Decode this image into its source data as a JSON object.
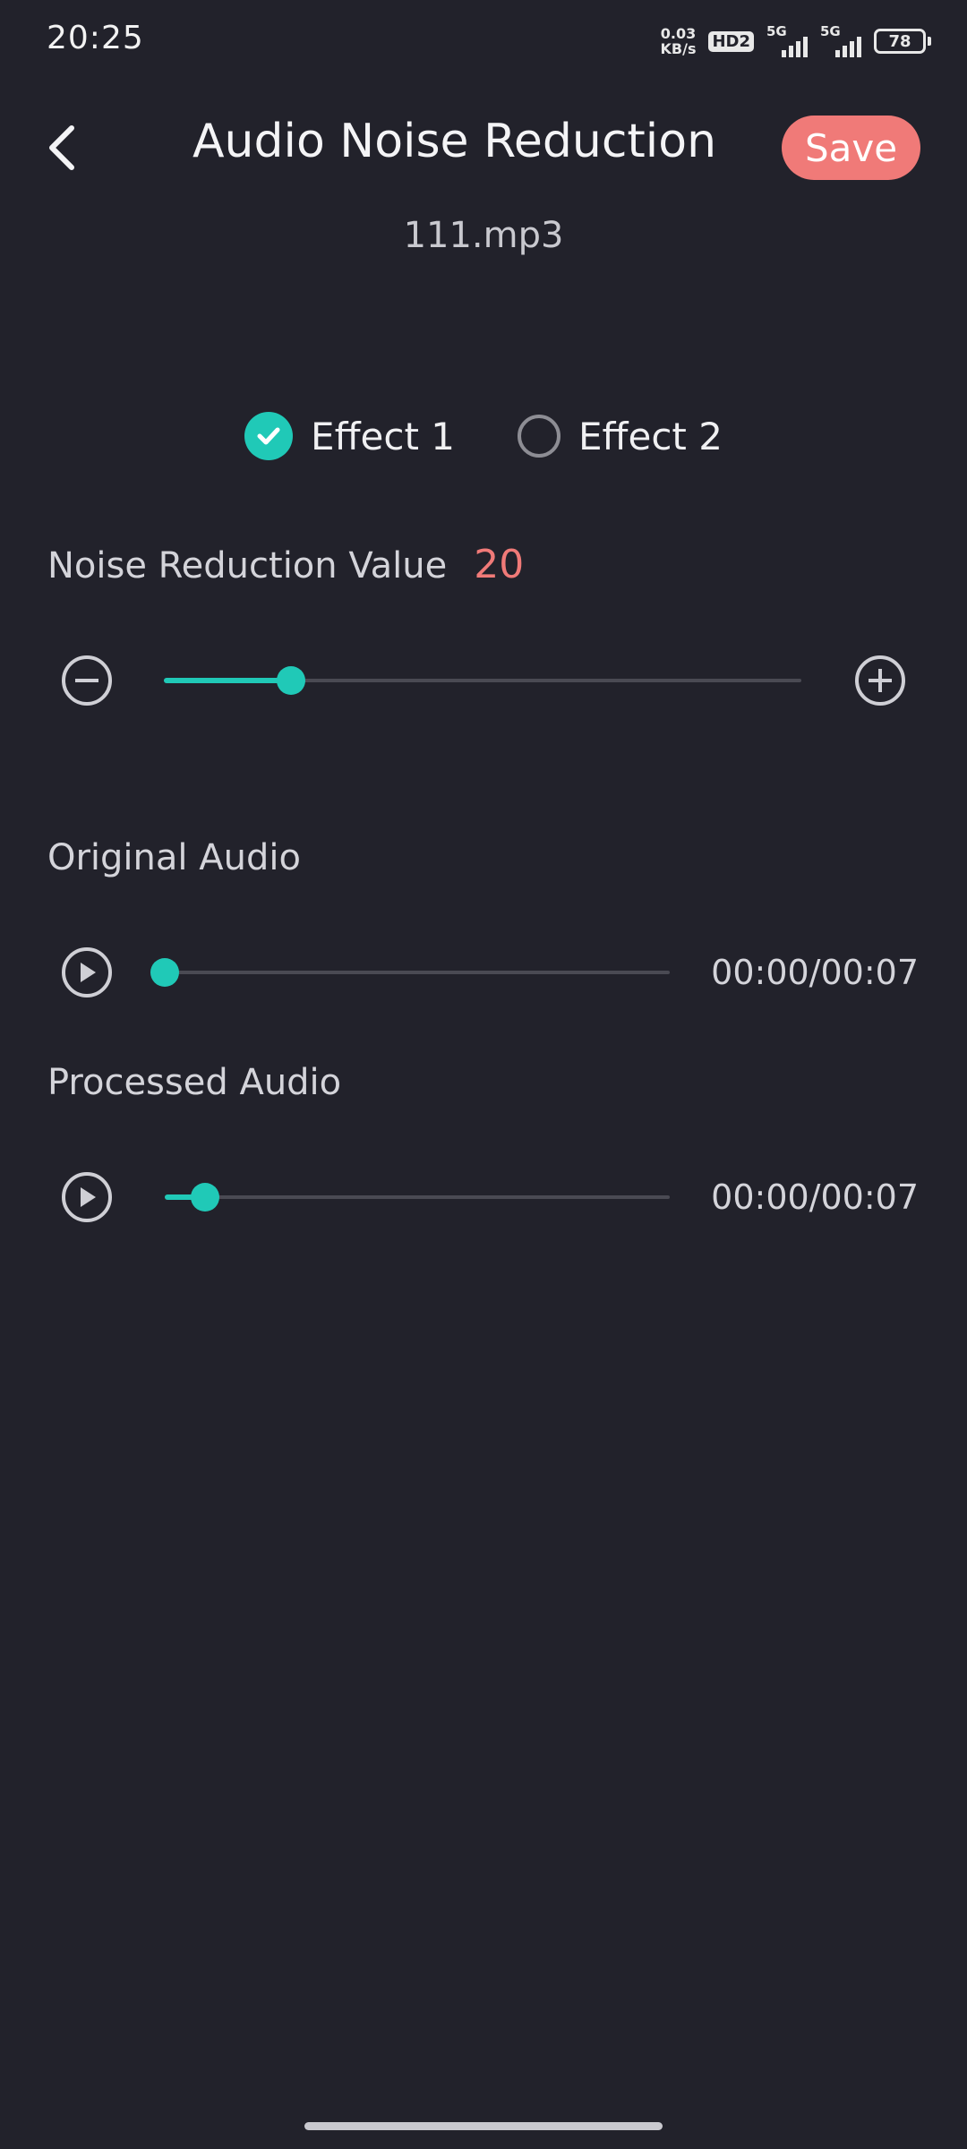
{
  "status_bar": {
    "time": "20:25",
    "net_speed_value": "0.03",
    "net_speed_unit": "KB/s",
    "hd_label": "HD2",
    "signal1_label": "5G",
    "signal2_label": "5G",
    "battery_level": "78"
  },
  "header": {
    "title": "Audio Noise Reduction",
    "save_label": "Save",
    "back_icon": "chevron-left-icon"
  },
  "file_name": "111.mp3",
  "effects": {
    "options": [
      {
        "label": "Effect 1",
        "selected": true
      },
      {
        "label": "Effect 2",
        "selected": false
      }
    ]
  },
  "noise_reduction": {
    "label": "Noise Reduction Value",
    "value": "20",
    "value_fraction": 0.2,
    "decrease_icon": "minus-circle-icon",
    "increase_icon": "plus-circle-icon"
  },
  "original_audio": {
    "label": "Original Audio",
    "time": "00:00/00:07",
    "progress_fraction": 0.0,
    "play_icon": "play-circle-icon"
  },
  "processed_audio": {
    "label": "Processed Audio",
    "time": "00:00/00:07",
    "progress_fraction": 0.08,
    "play_icon": "play-circle-icon"
  },
  "colors": {
    "accent": "#20c9b7",
    "save": "#f07a78",
    "background": "#22222b"
  }
}
